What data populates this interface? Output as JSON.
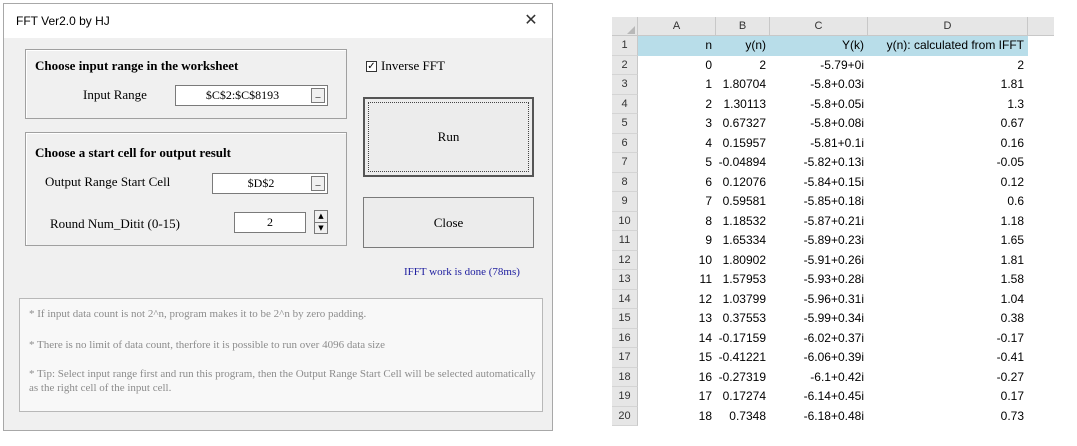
{
  "dialog": {
    "title": "FFT Ver2.0 by HJ",
    "close_glyph": "✕",
    "input_frame": {
      "title": "Choose input range in the worksheet",
      "input_label": "Input Range",
      "input_value": "$C$2:$C$8193",
      "refedit_glyph": "_"
    },
    "output_frame": {
      "title": "Choose a start cell  for output result",
      "output_label": "Output Range Start Cell",
      "output_value": "$D$2",
      "refedit_glyph": "_",
      "round_label": "Round Num_Ditit (0-15)",
      "round_value": "2",
      "spin_up": "▲",
      "spin_down": "▼"
    },
    "inverse_fft": {
      "label": "Inverse FFT",
      "checked": true,
      "check_glyph": "✓"
    },
    "run_label": "Run",
    "close_label": "Close",
    "status_text": "IFFT work is done (78ms)",
    "info": [
      "* If input data count  is not 2^n, program makes it to be 2^n by zero padding.",
      "* There is no limit of data count, therfore it is possible to run over 4096 data size",
      "* Tip: Select input range first and run this program, then the Output Range Start Cell will be selected automatically as the right cell of the input cell."
    ]
  },
  "sheet": {
    "columns": [
      "A",
      "B",
      "C",
      "D"
    ],
    "header_row": {
      "num": "1",
      "cells": [
        "n",
        "y(n)",
        "Y(k)",
        "y(n): calculated from IFFT"
      ]
    },
    "rows": [
      {
        "num": "2",
        "cells": [
          "0",
          "2",
          "-5.79+0i",
          "2"
        ]
      },
      {
        "num": "3",
        "cells": [
          "1",
          "1.80704",
          "-5.8+0.03i",
          "1.81"
        ]
      },
      {
        "num": "4",
        "cells": [
          "2",
          "1.30113",
          "-5.8+0.05i",
          "1.3"
        ]
      },
      {
        "num": "5",
        "cells": [
          "3",
          "0.67327",
          "-5.8+0.08i",
          "0.67"
        ]
      },
      {
        "num": "6",
        "cells": [
          "4",
          "0.15957",
          "-5.81+0.1i",
          "0.16"
        ]
      },
      {
        "num": "7",
        "cells": [
          "5",
          "-0.04894",
          "-5.82+0.13i",
          "-0.05"
        ]
      },
      {
        "num": "8",
        "cells": [
          "6",
          "0.12076",
          "-5.84+0.15i",
          "0.12"
        ]
      },
      {
        "num": "9",
        "cells": [
          "7",
          "0.59581",
          "-5.85+0.18i",
          "0.6"
        ]
      },
      {
        "num": "10",
        "cells": [
          "8",
          "1.18532",
          "-5.87+0.21i",
          "1.18"
        ]
      },
      {
        "num": "11",
        "cells": [
          "9",
          "1.65334",
          "-5.89+0.23i",
          "1.65"
        ]
      },
      {
        "num": "12",
        "cells": [
          "10",
          "1.80902",
          "-5.91+0.26i",
          "1.81"
        ]
      },
      {
        "num": "13",
        "cells": [
          "11",
          "1.57953",
          "-5.93+0.28i",
          "1.58"
        ]
      },
      {
        "num": "14",
        "cells": [
          "12",
          "1.03799",
          "-5.96+0.31i",
          "1.04"
        ]
      },
      {
        "num": "15",
        "cells": [
          "13",
          "0.37553",
          "-5.99+0.34i",
          "0.38"
        ]
      },
      {
        "num": "16",
        "cells": [
          "14",
          "-0.17159",
          "-6.02+0.37i",
          "-0.17"
        ]
      },
      {
        "num": "17",
        "cells": [
          "15",
          "-0.41221",
          "-6.06+0.39i",
          "-0.41"
        ]
      },
      {
        "num": "18",
        "cells": [
          "16",
          "-0.27319",
          "-6.1+0.42i",
          "-0.27"
        ]
      },
      {
        "num": "19",
        "cells": [
          "17",
          "0.17274",
          "-6.14+0.45i",
          "0.17"
        ]
      },
      {
        "num": "20",
        "cells": [
          "18",
          "0.7348",
          "-6.18+0.48i",
          "0.73"
        ]
      }
    ]
  }
}
